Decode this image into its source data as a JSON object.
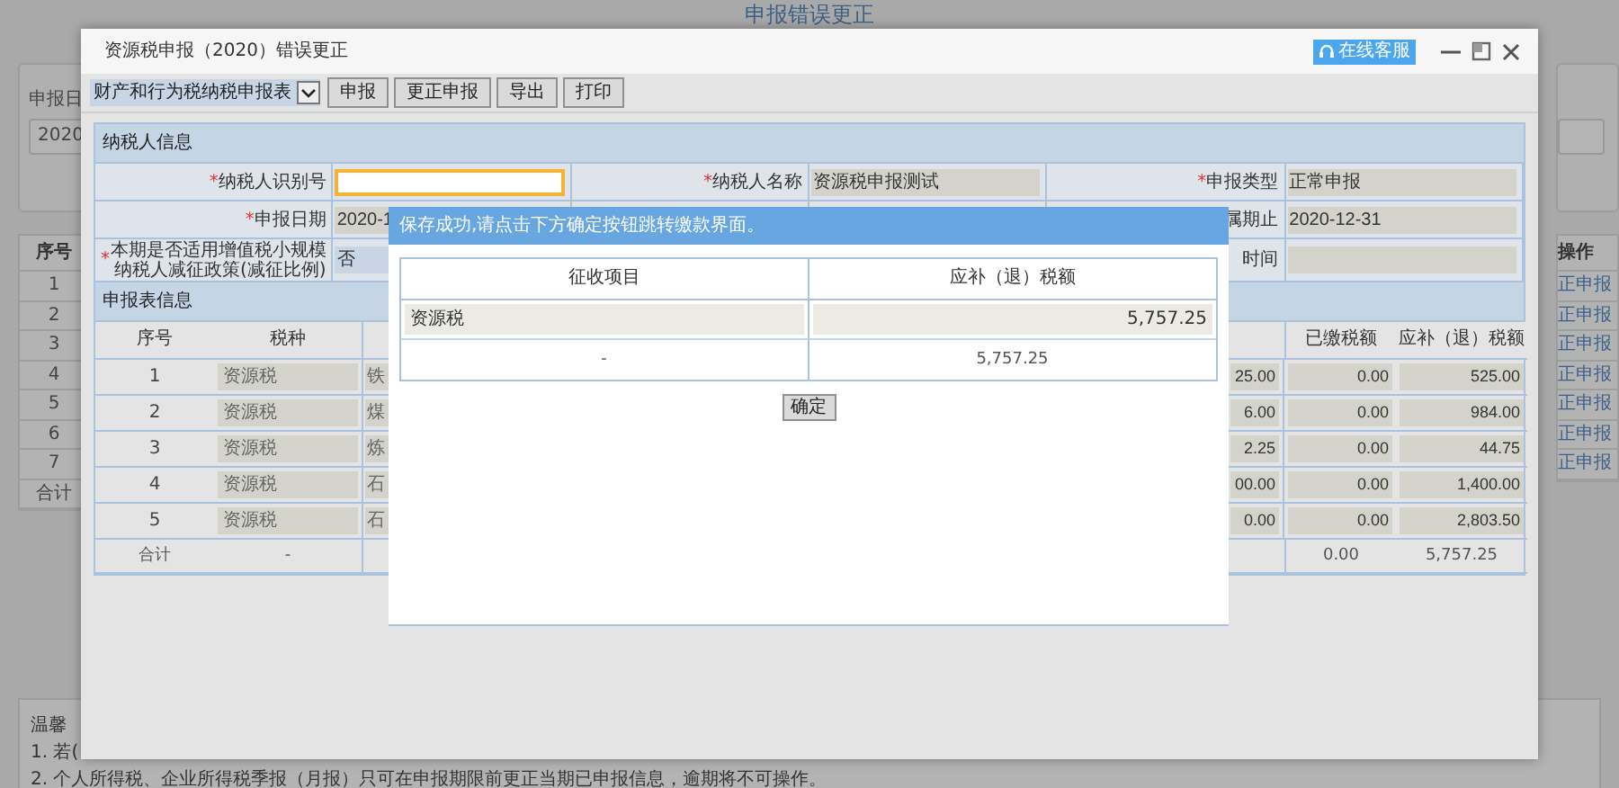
{
  "background": {
    "title": "申报错误更正",
    "date_label": "申报日",
    "date_value": "2020",
    "index_header": "序号",
    "index_rows": [
      "1",
      "2",
      "3",
      "4",
      "5",
      "6",
      "7"
    ],
    "index_total": "合计",
    "actions_header": "操作",
    "actions": [
      "正申报",
      "正申报",
      "正申报",
      "正申报",
      "正申报",
      "正申报",
      "正申报"
    ]
  },
  "notice": {
    "title": "温馨",
    "lines": [
      "1. 若(",
      "2. 个人所得税、企业所得税季报（月报）只可在申报期限前更正当期已申报信息，逾期将不可操作。"
    ]
  },
  "window": {
    "title": "资源税申报（2020）错误更正",
    "help_button": "在线客服"
  },
  "toolbar": {
    "select": "财产和行为税纳税申报表",
    "buttons": [
      "申报",
      "更正申报",
      "导出",
      "打印"
    ]
  },
  "taxpayer": {
    "title": "纳税人信息",
    "rows": [
      {
        "left": {
          "label": "*纳税人识别号",
          "required": true,
          "kind": "input",
          "focused": true
        },
        "middle": {
          "label": "*纳税人名称",
          "required": true,
          "kind": "text",
          "value": "资源税申报测试"
        },
        "right": {
          "label": "*申报类型",
          "required": true,
          "kind": "text",
          "value": "正常申报"
        }
      },
      {
        "left": {
          "label": "*申报日期",
          "required": true,
          "kind": "text",
          "value": "2020-1"
        },
        "right": {
          "label": "属期止",
          "required": false,
          "kind": "text",
          "value": "2020-12-31"
        }
      },
      {
        "left": {
          "label": "*本期是否适用增值税小规模纳税人减征政策(减征比例)",
          "required": true,
          "kind": "select",
          "value": "否"
        },
        "right": {
          "label": "时间",
          "required": false,
          "kind": "text"
        }
      }
    ]
  },
  "declaration": {
    "title": "申报表信息",
    "columns": [
      "序号",
      "税种",
      "已缴税额",
      "应补（退）税额"
    ],
    "rows": [
      {
        "no": "1",
        "tax": "资源税",
        "item": "铁",
        "amount": "25.00",
        "paid": "0.00",
        "due": "525.00"
      },
      {
        "no": "2",
        "tax": "资源税",
        "item": "煤",
        "amount": "6.00",
        "paid": "0.00",
        "due": "984.00"
      },
      {
        "no": "3",
        "tax": "资源税",
        "item": "炼",
        "amount": "2.25",
        "paid": "0.00",
        "due": "44.75"
      },
      {
        "no": "4",
        "tax": "资源税",
        "item": "石",
        "amount": "00.00",
        "paid": "0.00",
        "due": "1,400.00"
      },
      {
        "no": "5",
        "tax": "资源税",
        "item": "石",
        "amount": "0.00",
        "paid": "0.00",
        "due": "2,803.50"
      }
    ],
    "total": {
      "no": "合计",
      "tax": "-",
      "paid": "0.00",
      "due": "5,757.25"
    }
  },
  "dialog": {
    "message": "保存成功,请点击下方确定按钮跳转缴款界面。",
    "columns": [
      "征收项目",
      "应补（退）税额"
    ],
    "rows": [
      {
        "item": "资源税",
        "amount": "5,757.25"
      }
    ],
    "total": {
      "item": "-",
      "amount": "5,757.25"
    },
    "button": "确定"
  }
}
